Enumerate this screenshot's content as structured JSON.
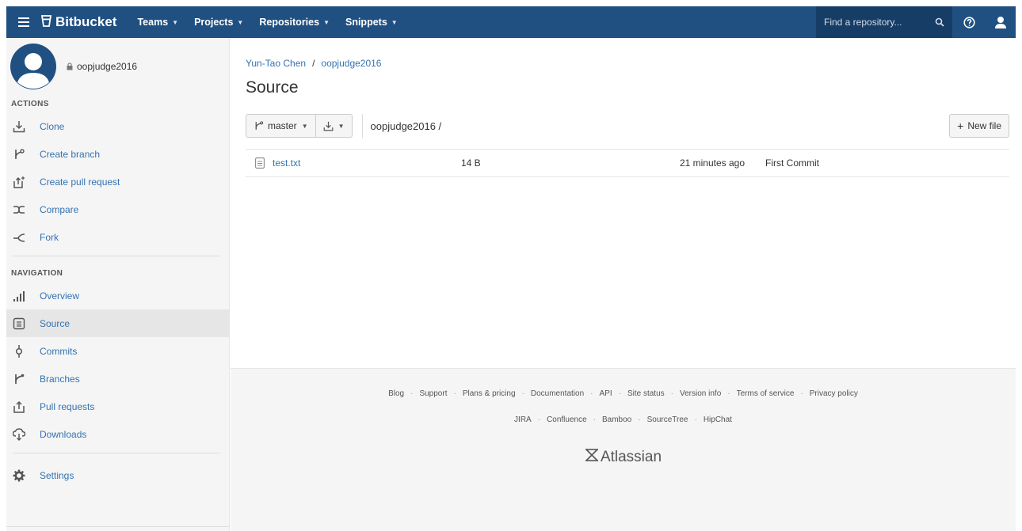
{
  "header": {
    "logo": "Bitbucket",
    "nav": [
      "Teams",
      "Projects",
      "Repositories",
      "Snippets"
    ],
    "search_placeholder": "Find a repository..."
  },
  "sidebar": {
    "repo_name": "oopjudge2016",
    "actions_heading": "ACTIONS",
    "actions": [
      {
        "label": "Clone",
        "icon": "clone-icon"
      },
      {
        "label": "Create branch",
        "icon": "branch-icon"
      },
      {
        "label": "Create pull request",
        "icon": "pull-request-icon"
      },
      {
        "label": "Compare",
        "icon": "compare-icon"
      },
      {
        "label": "Fork",
        "icon": "fork-icon"
      }
    ],
    "navigation_heading": "NAVIGATION",
    "navigation": [
      {
        "label": "Overview",
        "icon": "overview-icon"
      },
      {
        "label": "Source",
        "icon": "source-icon",
        "active": true
      },
      {
        "label": "Commits",
        "icon": "commits-icon"
      },
      {
        "label": "Branches",
        "icon": "branches-icon"
      },
      {
        "label": "Pull requests",
        "icon": "pull-requests-icon"
      },
      {
        "label": "Downloads",
        "icon": "downloads-icon"
      }
    ],
    "settings": {
      "label": "Settings",
      "icon": "gear-icon"
    }
  },
  "main": {
    "breadcrumb": {
      "owner": "Yun-Tao Chen",
      "separator": "/",
      "repo": "oopjudge2016"
    },
    "title": "Source",
    "branch": "master",
    "path": "oopjudge2016 /",
    "new_file_label": "New file",
    "files": [
      {
        "name": "test.txt",
        "size": "14 B",
        "date": "21 minutes ago",
        "message": "First Commit"
      }
    ]
  },
  "footer": {
    "links": [
      "Blog",
      "Support",
      "Plans & pricing",
      "Documentation",
      "API",
      "Site status",
      "Version info",
      "Terms of service",
      "Privacy policy"
    ],
    "products": [
      "JIRA",
      "Confluence",
      "Bamboo",
      "SourceTree",
      "HipChat"
    ],
    "brand": "Atlassian"
  },
  "colors": {
    "header": "#205081",
    "link": "#3572b0",
    "sidebar_bg": "#f5f5f5"
  }
}
